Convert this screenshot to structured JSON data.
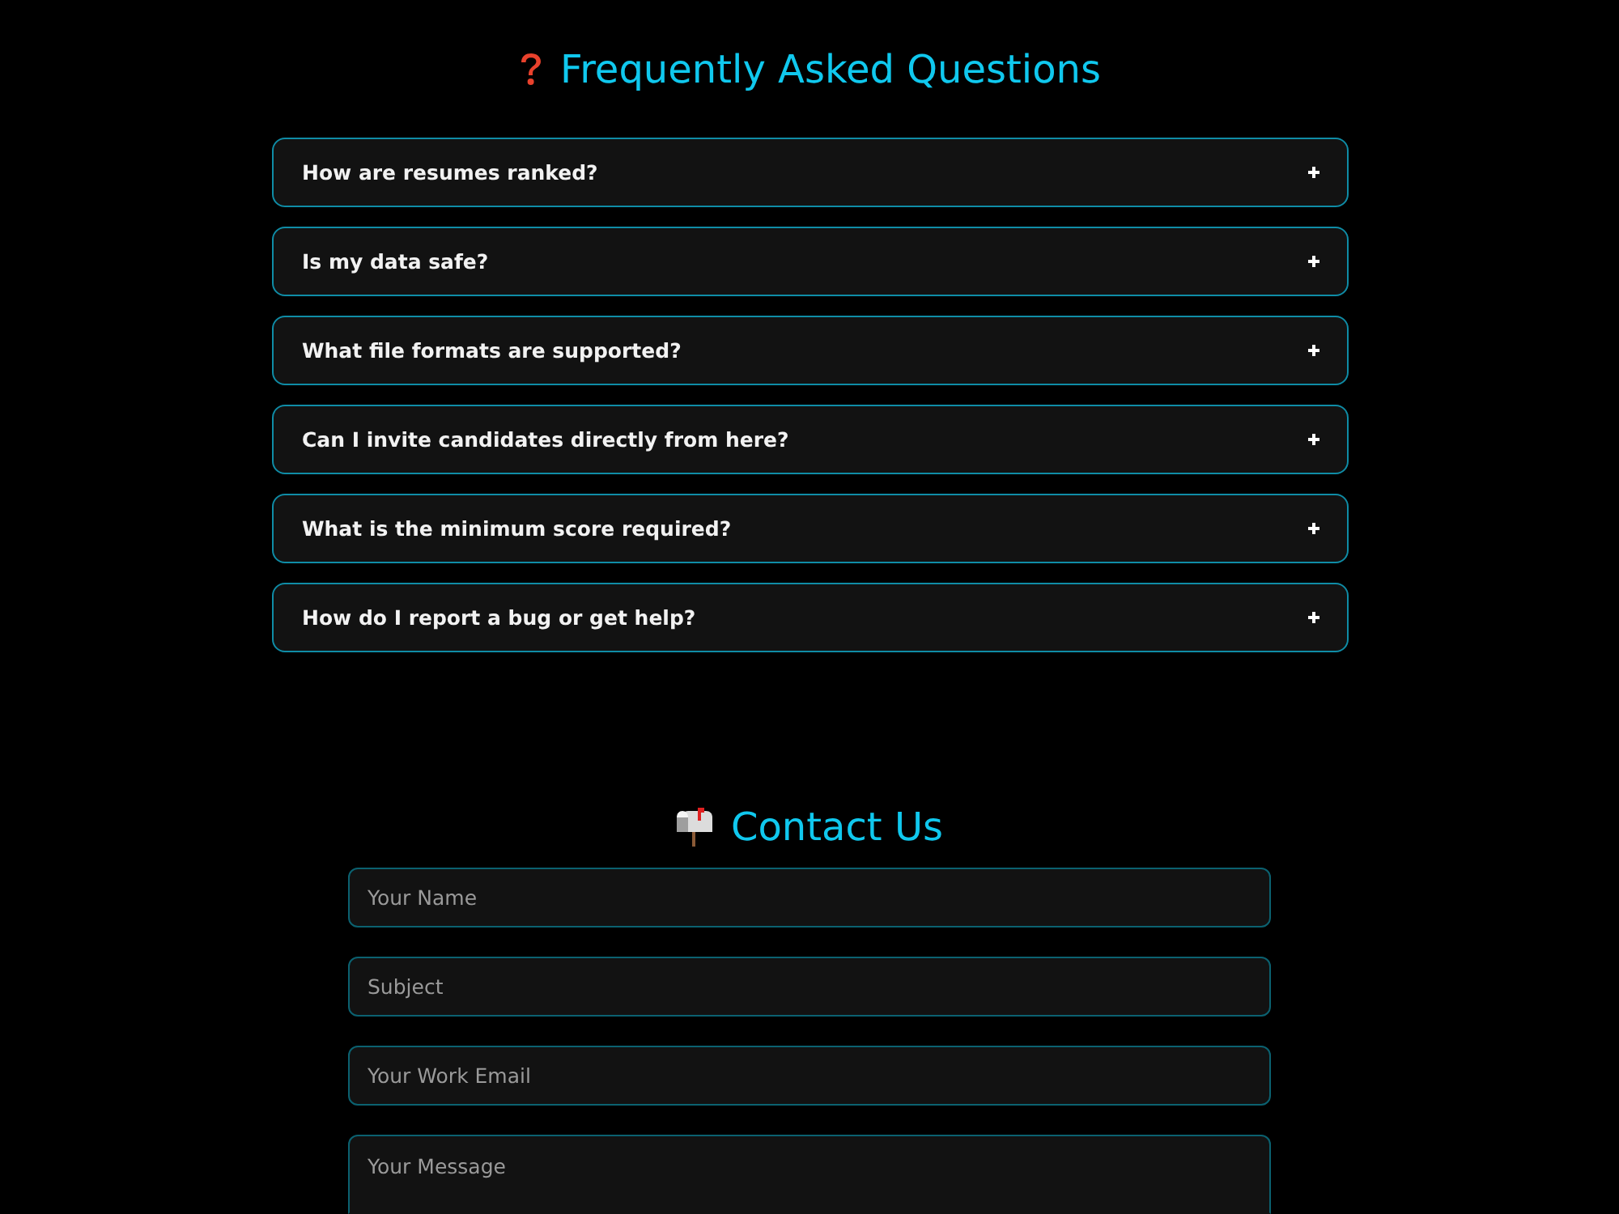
{
  "faq": {
    "title": "Frequently Asked Questions",
    "items": [
      {
        "question": "How are resumes ranked?",
        "expanded": false
      },
      {
        "question": "Is my data safe?",
        "expanded": false
      },
      {
        "question": "What file formats are supported?",
        "expanded": false
      },
      {
        "question": "Can I invite candidates directly from here?",
        "expanded": false
      },
      {
        "question": "What is the minimum score required?",
        "expanded": false
      },
      {
        "question": "How do I report a bug or get help?",
        "expanded": false
      }
    ]
  },
  "contact": {
    "title": "Contact Us",
    "fields": [
      {
        "kind": "input",
        "placeholder": "Your Name"
      },
      {
        "kind": "input",
        "placeholder": "Subject"
      },
      {
        "kind": "input",
        "placeholder": "Your Work Email"
      },
      {
        "kind": "textarea",
        "placeholder": "Your Message"
      }
    ]
  }
}
